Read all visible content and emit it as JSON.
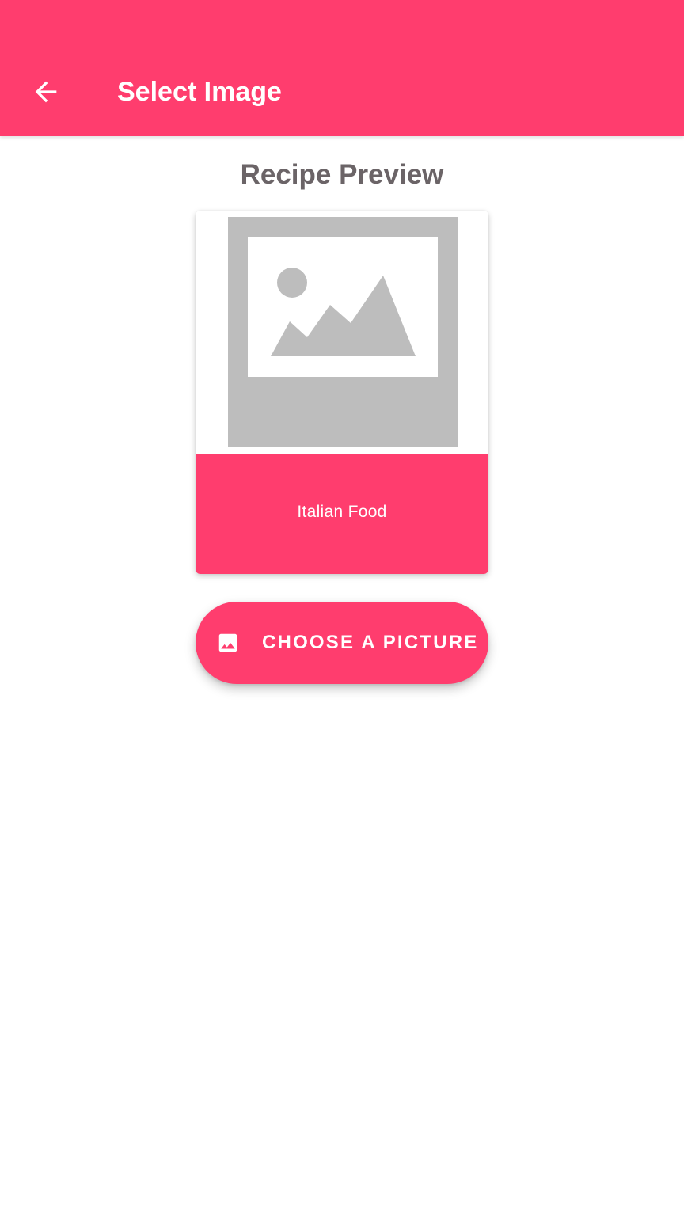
{
  "app_bar": {
    "title": "Select Image",
    "back_icon": "arrow-back-icon",
    "background_color": "#ff3d6e"
  },
  "main": {
    "section_title": "Recipe Preview",
    "card": {
      "image_icon": "image-placeholder-icon",
      "caption": "Italian Food",
      "caption_color": "#ff3d6e"
    },
    "choose_button": {
      "label": "CHOOSE A PICTURE",
      "icon": "image-icon"
    }
  }
}
